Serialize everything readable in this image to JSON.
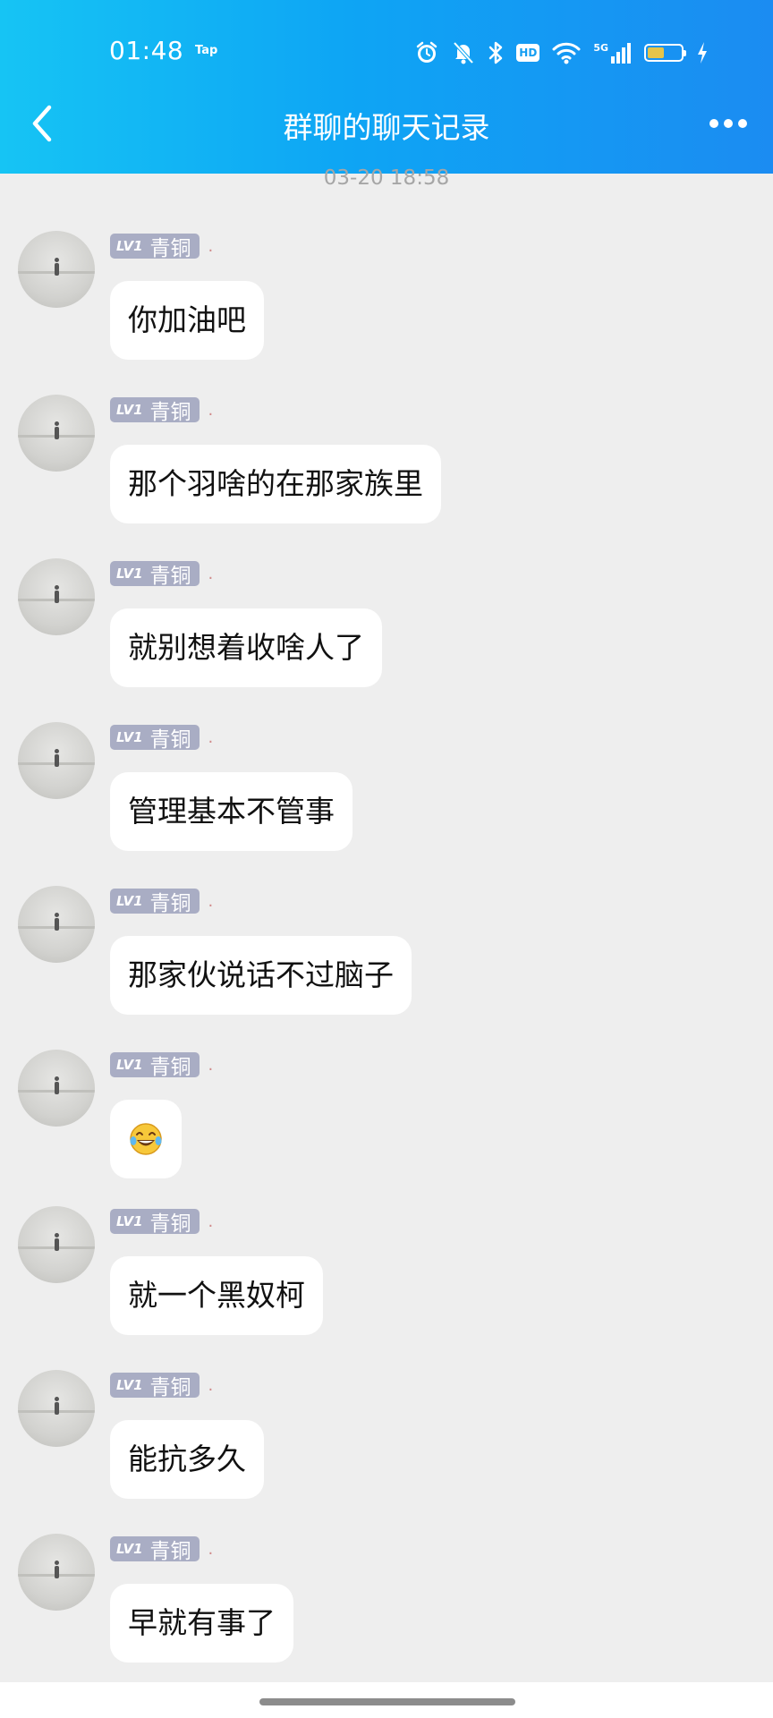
{
  "status_bar": {
    "time": "01:48",
    "app_label": "Tap",
    "network": "5G",
    "hd": "HD",
    "battery_level": 0.5
  },
  "header": {
    "title": "群聊的聊天记录"
  },
  "timestamp": "03-20 18:58",
  "badge": {
    "lv": "LV1",
    "title": "青铜"
  },
  "sender_name": ".",
  "messages": [
    {
      "text": "你加油吧"
    },
    {
      "text": "那个羽啥的在那家族里"
    },
    {
      "text": "就别想着收啥人了"
    },
    {
      "text": "管理基本不管事"
    },
    {
      "text": "那家伙说话不过脑子"
    },
    {
      "text": "",
      "emoji": "laughing-crying-emoji"
    },
    {
      "text": "就一个黑奴柯"
    },
    {
      "text": "能抗多久"
    },
    {
      "text": "早就有事了"
    }
  ],
  "colors": {
    "header_gradient_start": "#16c4f4",
    "header_gradient_end": "#1b8cf2",
    "background": "#eeeeee",
    "badge": "#a9adc4"
  }
}
